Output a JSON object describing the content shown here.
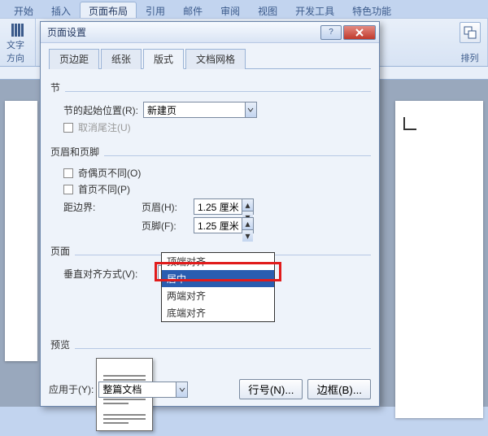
{
  "ribbon": {
    "tabs": [
      "开始",
      "插入",
      "页面布局",
      "引用",
      "邮件",
      "审阅",
      "视图",
      "开发工具",
      "特色功能"
    ],
    "active": 2,
    "group_orientation_caption": "文字方向",
    "group_arrange_caption": "排列"
  },
  "dialog": {
    "title": "页面设置",
    "tabs": [
      "页边距",
      "纸张",
      "版式",
      "文档网格"
    ],
    "active_tab": 2,
    "section": {
      "label": "节",
      "start_label": "节的起始位置(R):",
      "start_value": "新建页",
      "suppress_endnote_label": "取消尾注(U)"
    },
    "headerfooter": {
      "label": "页眉和页脚",
      "odd_even_label": "奇偶页不同(O)",
      "first_page_label": "首页不同(P)",
      "margin_label": "距边界:",
      "header_label": "页眉(H):",
      "header_value": "1.25 厘米",
      "footer_label": "页脚(F):",
      "footer_value": "1.25 厘米"
    },
    "page": {
      "label": "页面",
      "valign_label": "垂直对齐方式(V):",
      "valign_value": "居中",
      "valign_options": [
        "顶端对齐",
        "居中",
        "两端对齐",
        "底端对齐"
      ],
      "valign_selected_index": 1
    },
    "preview_label": "预览",
    "apply_to_label": "应用于(Y):",
    "apply_to_value": "整篇文档",
    "btn_line_numbers": "行号(N)...",
    "btn_borders": "边框(B)..."
  }
}
